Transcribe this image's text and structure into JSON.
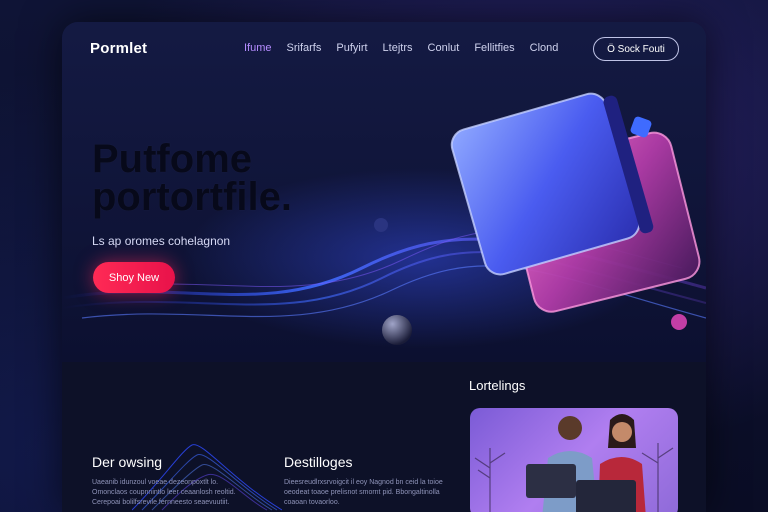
{
  "brand": "Pormlet",
  "nav": {
    "links": [
      "Ifume",
      "Srifarfs",
      "Pufyirt",
      "Ltejtrs",
      "Conlut",
      "Fellitfies",
      "Clond"
    ],
    "active_index": 0,
    "cta": "Ö Sock Fouti"
  },
  "hero": {
    "title_line1": "Putfome",
    "title_line2": "portortfile.",
    "subtitle": "Ls ap oromes cohelagnon",
    "button": "Shoy New"
  },
  "features": [
    {
      "title": "Der owsing",
      "text": "Uaeanib idunzoul voeae dezeonpoxtlt lo. Omonclaos coupnnintlo leer ceaanlosh reoltid. Cerepoai bolilfsrevile fernneesto seaevuutiit."
    },
    {
      "title": "Destilloges",
      "text": "Dieesreudlrxsrvoigcit il eoy Nagnod bn ceid la toioe oeodeat toaoe prelisnot smornt pid. Bbongaltinolla coaoan tovaorloo."
    }
  ],
  "latest": {
    "title": "Lortelings"
  },
  "colors": {
    "accent": "#b58cff",
    "cta_red": "#ff2a55",
    "background": "#0b0f2a"
  }
}
